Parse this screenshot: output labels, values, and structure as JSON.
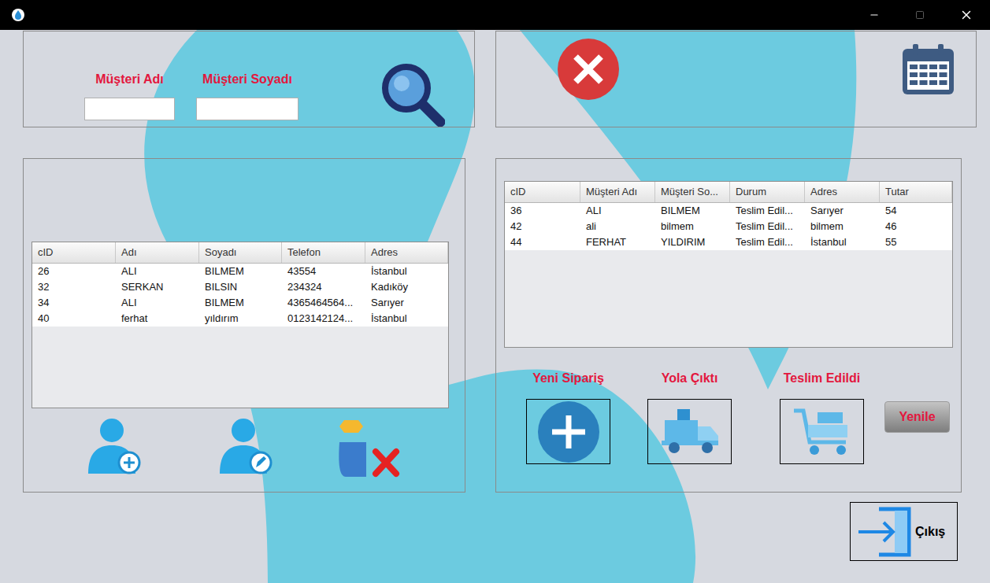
{
  "search": {
    "fields": [
      {
        "label": "Müşteri Adı",
        "value": ""
      },
      {
        "label": "Müşteri Soyadı",
        "value": ""
      }
    ]
  },
  "customers": {
    "columns": [
      "cID",
      "Adı",
      "Soyadı",
      "Telefon",
      "Adres"
    ],
    "rows": [
      [
        "26",
        "ALI",
        "BILMEM",
        "43554",
        "İstanbul"
      ],
      [
        "32",
        "SERKAN",
        "BILSIN",
        "234324",
        "Kadıköy"
      ],
      [
        "34",
        "ALI",
        "BILMEM",
        "4365464564...",
        "Sarıyer"
      ],
      [
        "40",
        "ferhat",
        "yıldırım",
        "0123142124...",
        "İstanbul"
      ]
    ]
  },
  "orders": {
    "columns": [
      "cID",
      "Müşteri Adı",
      "Müşteri So...",
      "Durum",
      "Adres",
      "Tutar"
    ],
    "rows": [
      [
        "36",
        "ALI",
        "BILMEM",
        "Teslim Edil...",
        "Sarıyer",
        "54"
      ],
      [
        "42",
        "ali",
        "bilmem",
        "Teslim Edil...",
        "bilmem",
        "46"
      ],
      [
        "44",
        "FERHAT",
        "YILDIRIM",
        "Teslim Edil...",
        "İstanbul",
        "55"
      ]
    ]
  },
  "order_actions": [
    {
      "label": "Yeni Sipariş",
      "kind": "new"
    },
    {
      "label": "Yola Çıktı",
      "kind": "shipped"
    },
    {
      "label": "Teslim Edildi",
      "kind": "delivered"
    }
  ],
  "refresh_button": "Yenile",
  "exit_button": "Çıkış"
}
